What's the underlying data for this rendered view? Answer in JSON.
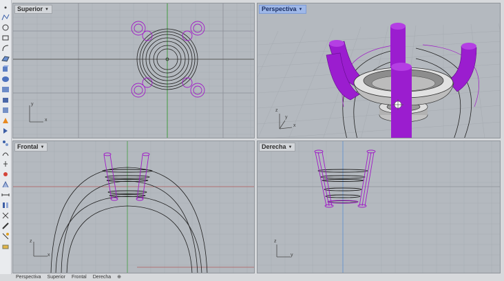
{
  "viewports": {
    "top_label": "Superior",
    "perspective_label": "Perspectiva",
    "front_label": "Frontal",
    "right_label": "Derecha"
  },
  "axes": {
    "top": {
      "v": "y",
      "h": "x"
    },
    "perspective": {
      "v": "z",
      "h": "x",
      "d": "y"
    },
    "front": {
      "v": "z",
      "h": "x"
    },
    "right": {
      "v": "z",
      "h": "y"
    }
  },
  "bottom_tabs": {
    "t1": "Perspectiva",
    "t2": "Superior",
    "t3": "Frontal",
    "t4": "Derecha",
    "add": "⊕"
  },
  "colors": {
    "selection": "#a019c8",
    "viewport_bg": "#b4b9bf",
    "active_title": "#9fb8e8"
  },
  "toolbar_icons": [
    "point-icon",
    "curve-icon",
    "circle-icon",
    "rectangle-icon",
    "arc-icon",
    "surface-icon",
    "solid-icon",
    "mesh-icon",
    "transform-icon",
    "boolean-icon",
    "dimension-icon",
    "analyze-icon",
    "render-icon",
    "layer-icon",
    "properties-icon",
    "text-icon",
    "snap-icon",
    "group-icon",
    "array-icon",
    "mirror-icon",
    "explode-icon",
    "join-icon",
    "trim-icon",
    "split-icon",
    "fillet-icon",
    "sweep-icon",
    "loft-icon"
  ]
}
